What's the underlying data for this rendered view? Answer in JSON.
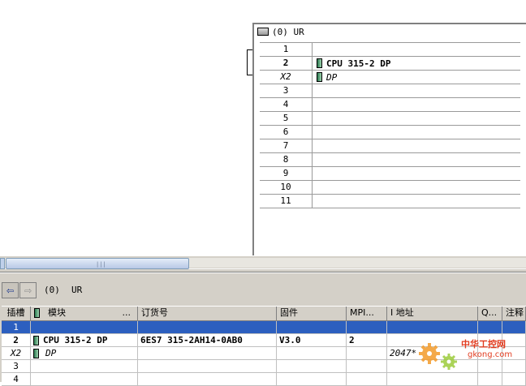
{
  "rack": {
    "title": "(0)  UR",
    "rows": [
      {
        "slot": "1",
        "module": ""
      },
      {
        "slot": "2",
        "module": "CPU 315-2 DP"
      },
      {
        "slot": "X2",
        "module": "DP"
      },
      {
        "slot": "3",
        "module": ""
      },
      {
        "slot": "4",
        "module": ""
      },
      {
        "slot": "5",
        "module": ""
      },
      {
        "slot": "6",
        "module": ""
      },
      {
        "slot": "7",
        "module": ""
      },
      {
        "slot": "8",
        "module": ""
      },
      {
        "slot": "9",
        "module": ""
      },
      {
        "slot": "10",
        "module": ""
      },
      {
        "slot": "11",
        "module": ""
      }
    ]
  },
  "scrollbar": {
    "grip": "|||"
  },
  "bottom": {
    "nav_back": "⇦",
    "nav_forward": "⇨",
    "path_station": "(0)",
    "path_rack": "UR",
    "columns": [
      "插槽",
      "模块",
      "订货号",
      "固件",
      "MPI...",
      "I 地址",
      "Q...",
      "注释"
    ],
    "module_dots": "...",
    "rows": [
      {
        "slot": "1",
        "module": "",
        "order": "",
        "firmware": "",
        "mpi": "",
        "i_addr": "",
        "q": "",
        "comment": ""
      },
      {
        "slot": "2",
        "module": "CPU 315-2 DP",
        "order": "6ES7 315-2AH14-0AB0",
        "firmware": "V3.0",
        "mpi": "2",
        "i_addr": "",
        "q": "",
        "comment": ""
      },
      {
        "slot": "X2",
        "module": "DP",
        "order": "",
        "firmware": "",
        "mpi": "",
        "i_addr": "2047*",
        "q": "",
        "comment": ""
      },
      {
        "slot": "3",
        "module": "",
        "order": "",
        "firmware": "",
        "mpi": "",
        "i_addr": "",
        "q": "",
        "comment": ""
      },
      {
        "slot": "4",
        "module": "",
        "order": "",
        "firmware": "",
        "mpi": "",
        "i_addr": "",
        "q": "",
        "comment": ""
      }
    ]
  },
  "watermark": {
    "line1": "中华工控网",
    "line2": "gkong.com"
  },
  "colors": {
    "selection": "#2c5fbf",
    "panel": "#d4d0c8",
    "watermark": "#e23b1f"
  }
}
